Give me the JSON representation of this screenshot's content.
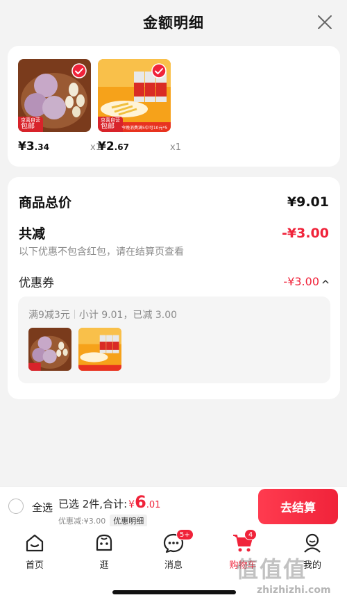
{
  "sheet": {
    "title": "金额明细"
  },
  "products": [
    {
      "price_int": "¥3",
      "price_cents": ".34",
      "qty": "x1",
      "free_tag_top": "京喜自营",
      "free_tag": "包邮"
    },
    {
      "price_int": "¥2",
      "price_cents": ".67",
      "qty": "x1",
      "free_tag_top": "京喜自营",
      "free_tag": "包邮",
      "banner": "今晚消费满5中可10元*5"
    }
  ],
  "summary": {
    "total_label": "商品总价",
    "total_value": "¥9.01",
    "discount_label": "共减",
    "discount_value": "-¥3.00",
    "note": "以下优惠不包含红包，请在结算页查看",
    "coupon_label": "优惠券",
    "coupon_value": "-¥3.00",
    "coupon_rule": "满9减3元",
    "coupon_detail": "小计 9.01，已减 3.00"
  },
  "checkout": {
    "select_all": "全选",
    "selected_text": "已选 2件,合计:",
    "currency": "¥",
    "amount_int": "6",
    "amount_cents": ".01",
    "discount_text": "优惠减:¥3.00",
    "detail_chip": "优惠明细",
    "button": "去结算"
  },
  "tabs": [
    {
      "label": "首页"
    },
    {
      "label": "逛"
    },
    {
      "label": "消息",
      "badge": "5+"
    },
    {
      "label": "购物车",
      "badge": "4"
    },
    {
      "label": "我的"
    }
  ],
  "watermark": {
    "text": "值值值",
    "url": "zhizhizhi.com"
  },
  "colors": {
    "accent": "#f0233a",
    "background": "#f3f3f3"
  }
}
